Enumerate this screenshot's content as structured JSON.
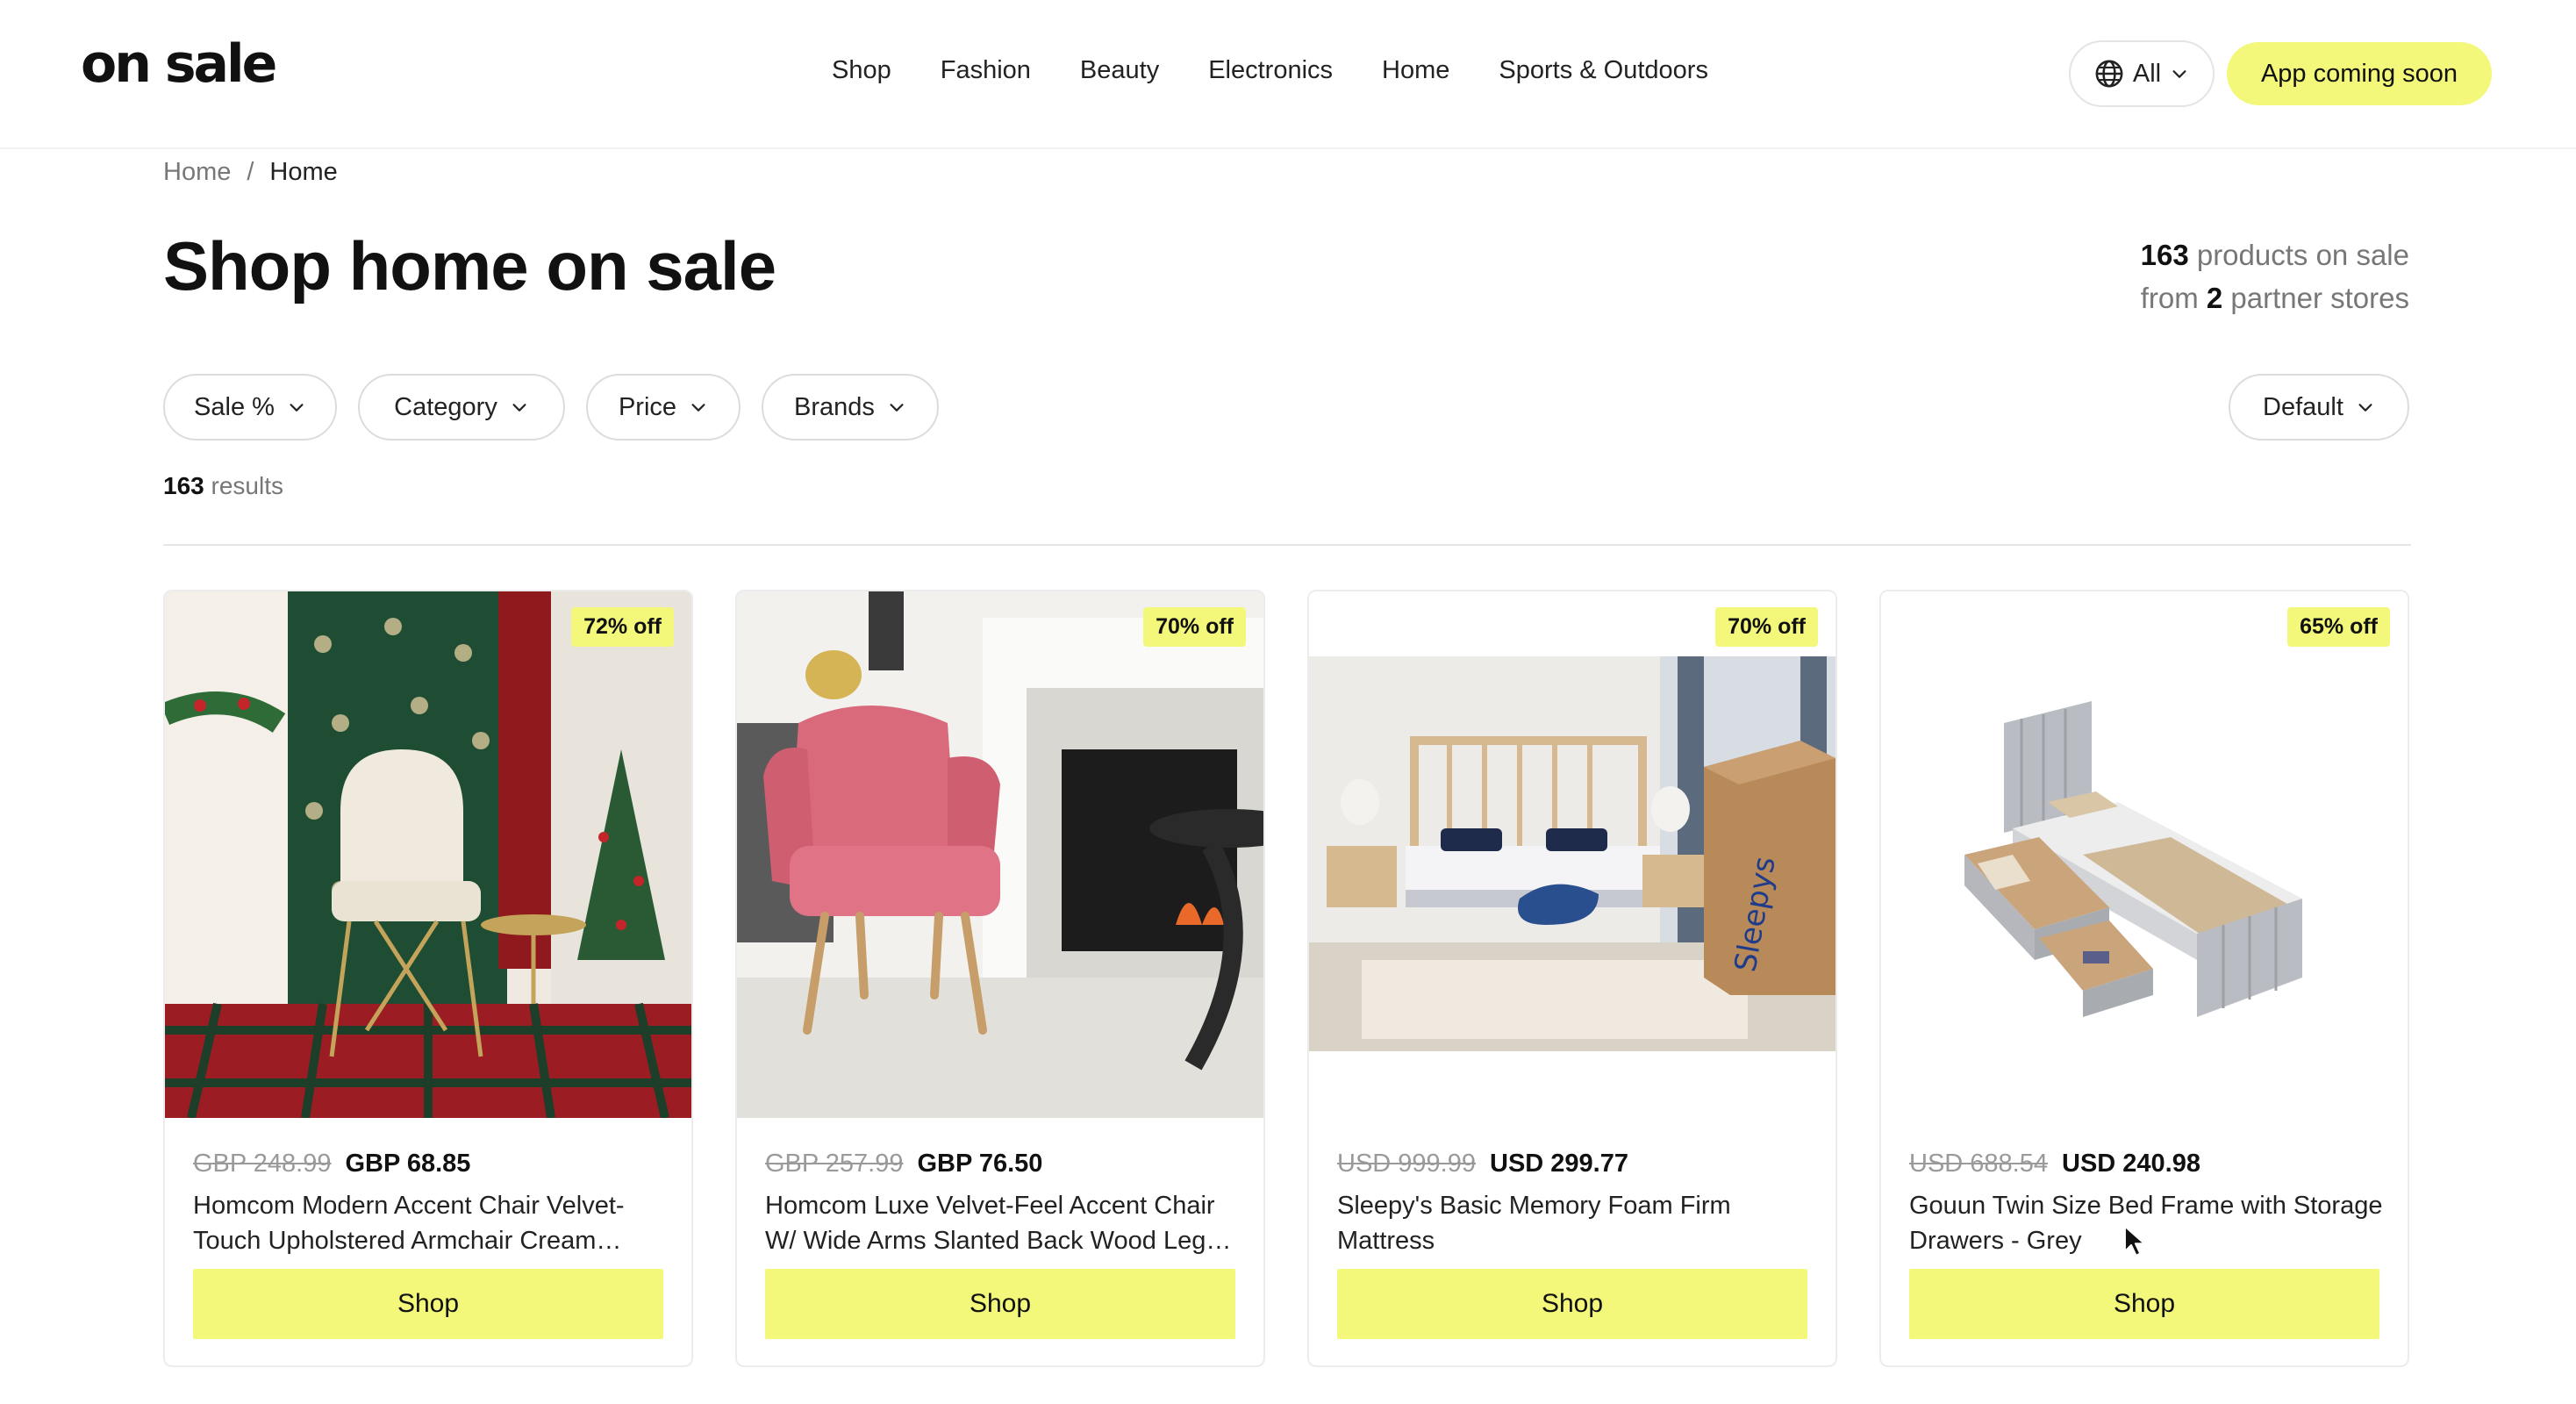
{
  "header": {
    "logo": "on sale",
    "nav": [
      "Shop",
      "Fashion",
      "Beauty",
      "Electronics",
      "Home",
      "Sports & Outdoors"
    ],
    "region_label": "All",
    "app_button": "App coming soon"
  },
  "breadcrumb": {
    "home": "Home",
    "separator": "/",
    "current": "Home"
  },
  "page_title": "Shop home on sale",
  "stats": {
    "product_count": "163",
    "products_text": "products on sale",
    "from_text": "from",
    "store_count": "2",
    "stores_text": "partner stores"
  },
  "filters": [
    "Sale %",
    "Category",
    "Price",
    "Brands"
  ],
  "sort": "Default",
  "results": {
    "count": "163",
    "label": "results"
  },
  "products": [
    {
      "badge": "72% off",
      "old_price": "GBP 248.99",
      "new_price": "GBP 68.85",
      "title": "Homcom Modern Accent Chair Velvet-Touch Upholstered Armchair Cream…",
      "button": "Shop"
    },
    {
      "badge": "70% off",
      "old_price": "GBP 257.99",
      "new_price": "GBP 76.50",
      "title": "Homcom Luxe Velvet-Feel Accent Chair W/ Wide Arms Slanted Back Wood Leg…",
      "button": "Shop"
    },
    {
      "badge": "70% off",
      "old_price": "USD 999.99",
      "new_price": "USD 299.77",
      "title": "Sleepy's Basic Memory Foam Firm Mattress",
      "button": "Shop",
      "image_text": "Sleepys"
    },
    {
      "badge": "65% off",
      "old_price": "USD 688.54",
      "new_price": "USD 240.98",
      "title": "Gouun Twin Size Bed Frame with Storage Drawers - Grey",
      "button": "Shop"
    }
  ],
  "colors": {
    "accent": "#f3f87b",
    "text": "#111111",
    "muted": "#777777",
    "border": "#dcdcdc"
  },
  "icons": [
    "globe-icon",
    "chevron-down-icon",
    "mouse-cursor-icon"
  ]
}
